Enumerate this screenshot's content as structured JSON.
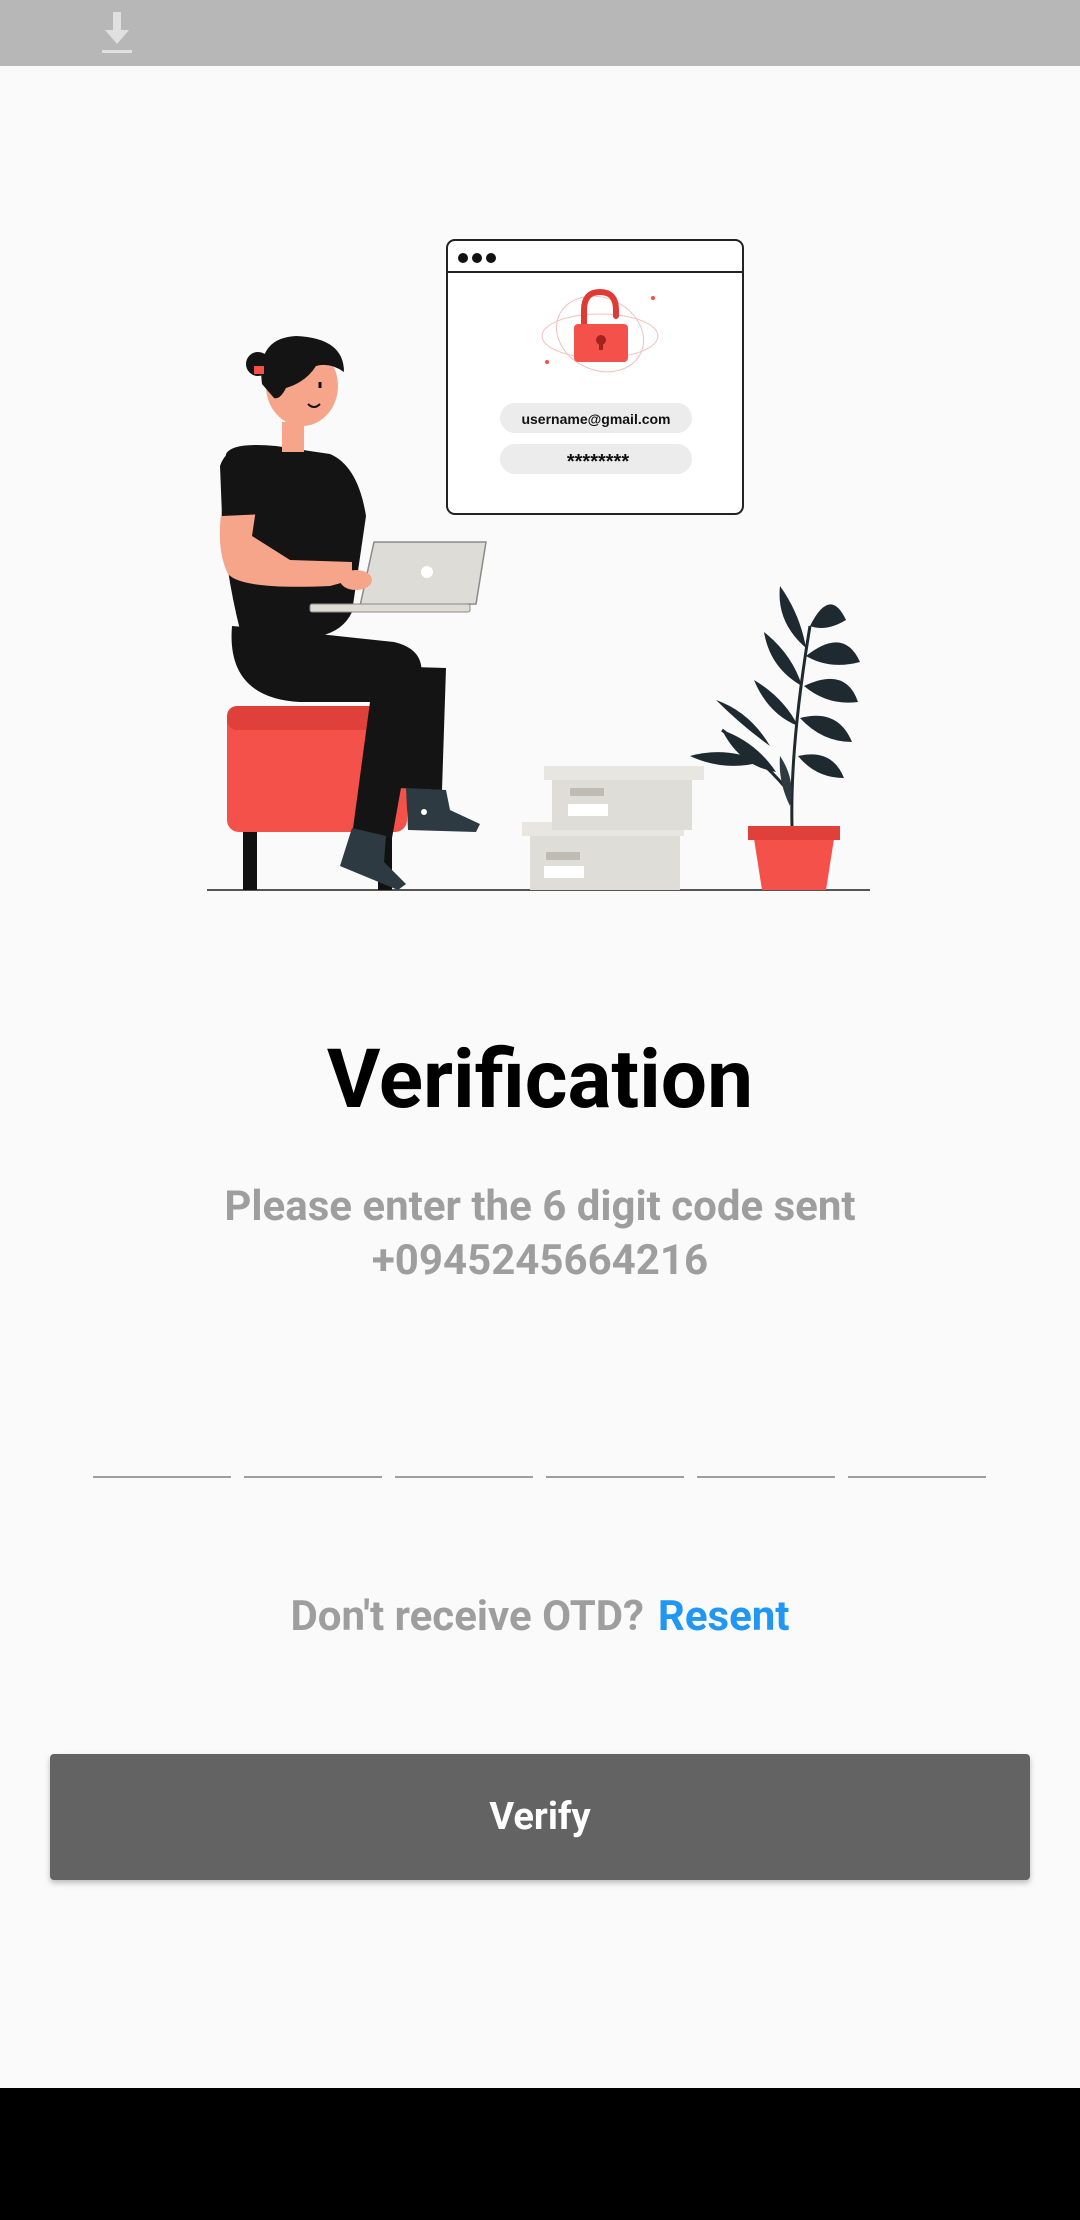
{
  "status_bar": {
    "icons": [
      "download-icon"
    ]
  },
  "illustration": {
    "login_window": {
      "username_text": "username@gmail.com",
      "password_text": "********"
    }
  },
  "verification": {
    "title": "Verification",
    "subtitle_line1": "Please enter the 6 digit code sent",
    "subtitle_line2": "+0945245664216",
    "otp_digits": [
      "",
      "",
      "",
      "",
      "",
      ""
    ],
    "resend_prompt": "Don't receive OTD?",
    "resend_link": "Resent",
    "verify_button": "Verify"
  },
  "colors": {
    "background": "#fafafa",
    "accent_link": "#2196f3",
    "button": "#636363",
    "muted_text": "#9e9e9e",
    "illustration_red": "#f4514b"
  }
}
